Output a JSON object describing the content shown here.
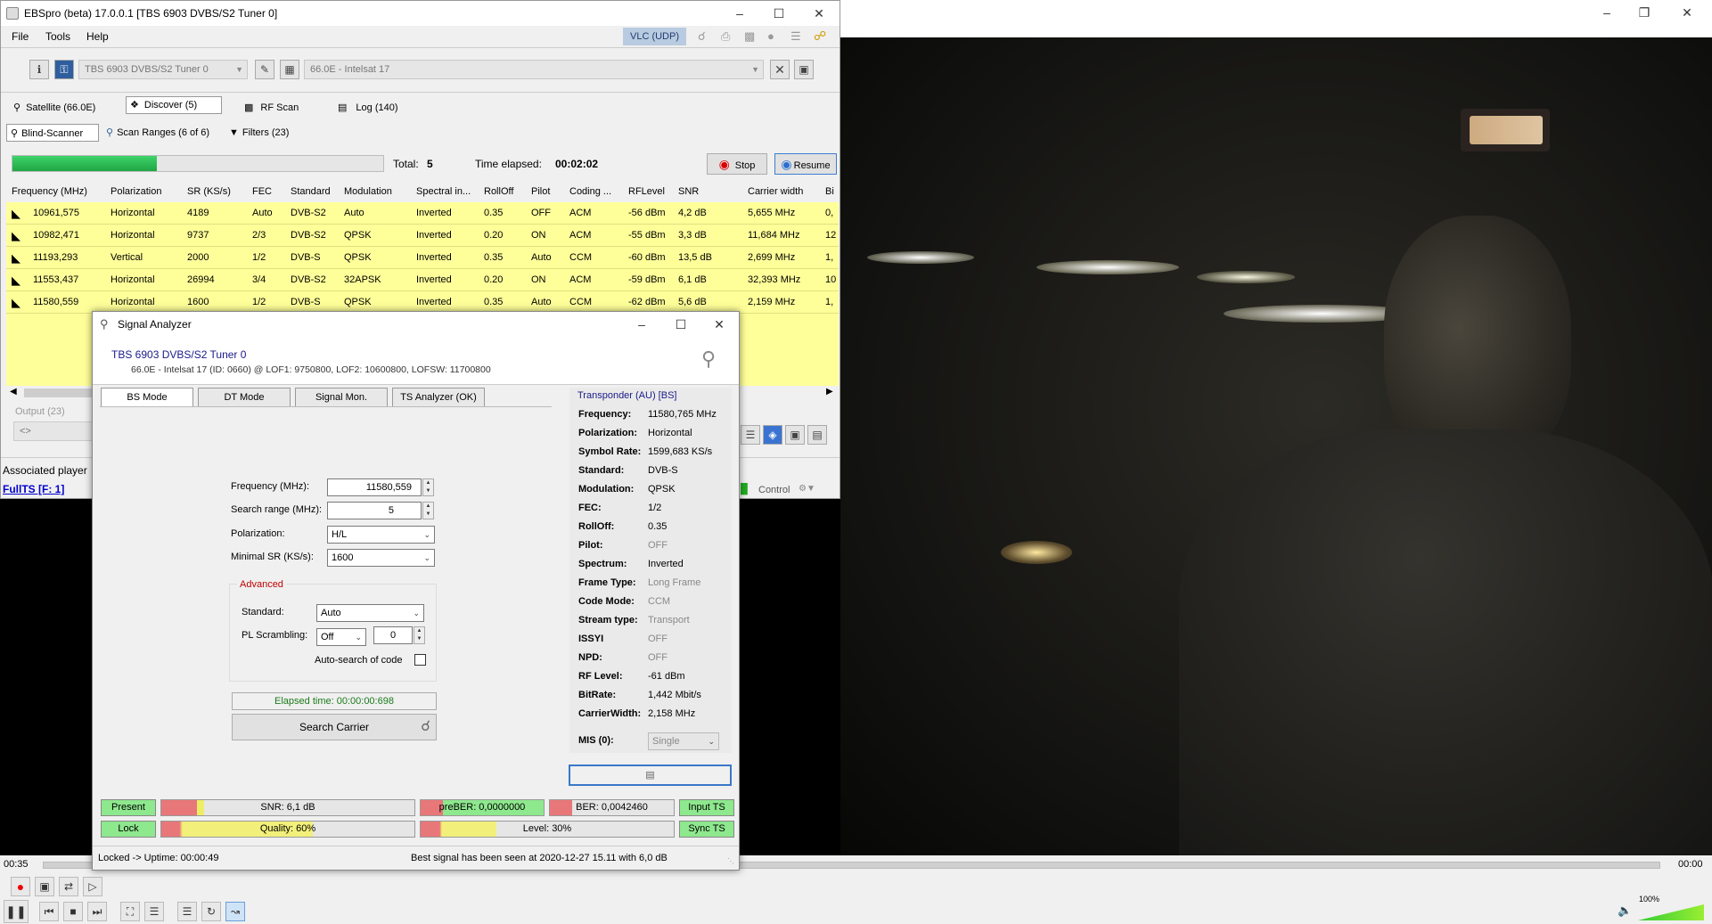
{
  "ebs": {
    "title": "EBSpro (beta) 17.0.0.1 [TBS 6903 DVBS/S2 Tuner 0]",
    "menu": [
      "File",
      "Tools",
      "Help"
    ],
    "vlc_udp": "VLC (UDP)",
    "tuner": "TBS 6903 DVBS/S2 Tuner 0",
    "satellite": "66.0E - Intelsat 17",
    "tabs": [
      "Satellite (66.0E)",
      "Discover (5)",
      "RF Scan",
      "Log (140)"
    ],
    "subtabs": [
      "Blind-Scanner",
      "Scan Ranges (6 of 6)",
      "Filters (23)"
    ],
    "progress": 0.39,
    "total_label": "Total:",
    "total_value": "5",
    "elapsed_label": "Time elapsed:",
    "elapsed_value": "00:02:02",
    "stop": "Stop",
    "resume": "Resume",
    "columns": [
      "Frequency (MHz)",
      "Polarization",
      "SR (KS/s)",
      "FEC",
      "Standard",
      "Modulation",
      "Spectral in...",
      "RollOff",
      "Pilot",
      "Coding ...",
      "RFLevel",
      "SNR",
      "Carrier width",
      "Bi"
    ],
    "rows": [
      [
        "10961,575",
        "Horizontal",
        "4189",
        "Auto",
        "DVB-S2",
        "Auto",
        "Inverted",
        "0.35",
        "OFF",
        "ACM",
        "-56 dBm",
        "4,2 dB",
        "5,655 MHz",
        "0,"
      ],
      [
        "10982,471",
        "Horizontal",
        "9737",
        "2/3",
        "DVB-S2",
        "QPSK",
        "Inverted",
        "0.20",
        "ON",
        "ACM",
        "-55 dBm",
        "3,3 dB",
        "11,684 MHz",
        "12"
      ],
      [
        "11193,293",
        "Vertical",
        "2000",
        "1/2",
        "DVB-S",
        "QPSK",
        "Inverted",
        "0.35",
        "Auto",
        "CCM",
        "-60 dBm",
        "13,5 dB",
        "2,699 MHz",
        "1,"
      ],
      [
        "11553,437",
        "Horizontal",
        "26994",
        "3/4",
        "DVB-S2",
        "32APSK",
        "Inverted",
        "0.20",
        "ON",
        "ACM",
        "-59 dBm",
        "6,1 dB",
        "32,393 MHz",
        "10"
      ],
      [
        "11580,559",
        "Horizontal",
        "1600",
        "1/2",
        "DVB-S",
        "QPSK",
        "Inverted",
        "0.35",
        "Auto",
        "CCM",
        "-62 dBm",
        "5,6 dB",
        "2,159 MHz",
        "1,"
      ]
    ],
    "output_label": "Output (23)",
    "output_field": "<>",
    "associated": "Associated player",
    "fullts": "FullTS [F: 1]",
    "control": "Control"
  },
  "sa": {
    "title": "Signal Analyzer",
    "tuner": "TBS 6903 DVBS/S2 Tuner 0",
    "info": "66.0E - Intelsat 17 (ID: 0660) @ LOF1: 9750800, LOF2: 10600800, LOFSW: 11700800",
    "tabs": [
      "BS Mode",
      "DT Mode",
      "Signal Mon.",
      "TS Analyzer (OK)"
    ],
    "freq_label": "Frequency (MHz):",
    "freq_value": "11580,559",
    "range_label": "Search range (MHz):",
    "range_value": "5",
    "pol_label": "Polarization:",
    "pol_value": "H/L",
    "minsr_label": "Minimal SR (KS/s):",
    "minsr_value": "1600",
    "advanced": "Advanced",
    "standard_label": "Standard:",
    "standard_value": "Auto",
    "pls_label": "PL Scrambling:",
    "pls_value": "Off",
    "pls_code": "0",
    "autosearch": "Auto-search of code",
    "elapsed": "Elapsed time: 00:00:00:698",
    "search": "Search Carrier",
    "transponder_title": "Transponder (AU) [BS]",
    "transponder": [
      {
        "k": "Frequency:",
        "v": "11580,765 MHz",
        "dim": false
      },
      {
        "k": "Polarization:",
        "v": "Horizontal",
        "dim": false
      },
      {
        "k": "Symbol Rate:",
        "v": "1599,683 KS/s",
        "dim": false
      },
      {
        "k": "Standard:",
        "v": "DVB-S",
        "dim": false
      },
      {
        "k": "Modulation:",
        "v": "QPSK",
        "dim": false
      },
      {
        "k": "FEC:",
        "v": "1/2",
        "dim": false
      },
      {
        "k": "RollOff:",
        "v": "0.35",
        "dim": false
      },
      {
        "k": "Pilot:",
        "v": "OFF",
        "dim": true
      },
      {
        "k": "Spectrum:",
        "v": "Inverted",
        "dim": false
      },
      {
        "k": "Frame Type:",
        "v": "Long Frame",
        "dim": true
      },
      {
        "k": "Code Mode:",
        "v": "CCM",
        "dim": true
      },
      {
        "k": "Stream type:",
        "v": "Transport",
        "dim": true
      },
      {
        "k": "ISSYI",
        "v": "OFF",
        "dim": true
      },
      {
        "k": "NPD:",
        "v": "OFF",
        "dim": true
      },
      {
        "k": "RF Level:",
        "v": "-61 dBm",
        "dim": false
      },
      {
        "k": "BitRate:",
        "v": "1,442 Mbit/s",
        "dim": false
      },
      {
        "k": "CarrierWidth:",
        "v": "2,158 MHz",
        "dim": false
      }
    ],
    "mis_label": "MIS (0):",
    "mis_value": "Single",
    "present": "Present",
    "lock": "Lock",
    "snr": "SNR: 6,1 dB",
    "quality": "Quality: 60%",
    "quality_value": 0.6,
    "preber": "preBER: 0,0000000",
    "ber": "BER: 0,0042460",
    "level": "Level: 30%",
    "level_value": 0.3,
    "input_ts": "Input TS",
    "sync_ts": "Sync TS",
    "status_left": "Locked -> Uptime: 00:00:49",
    "status_right": "Best signal has been seen at 2020-12-27 15.11 with 6,0 dB"
  },
  "vlc": {
    "time_left": "00:35",
    "time_right": "00:00",
    "volume": "100%",
    "volume_value": 1.0,
    "seek_value": 0.0
  },
  "colors": {
    "row_yellow": "#ffff99",
    "progress_green": "#22b14c",
    "status_green": "#8ee88e",
    "link_blue": "#0000cc",
    "title_navy": "#1a1a8a",
    "advanced_red": "#c00000"
  }
}
